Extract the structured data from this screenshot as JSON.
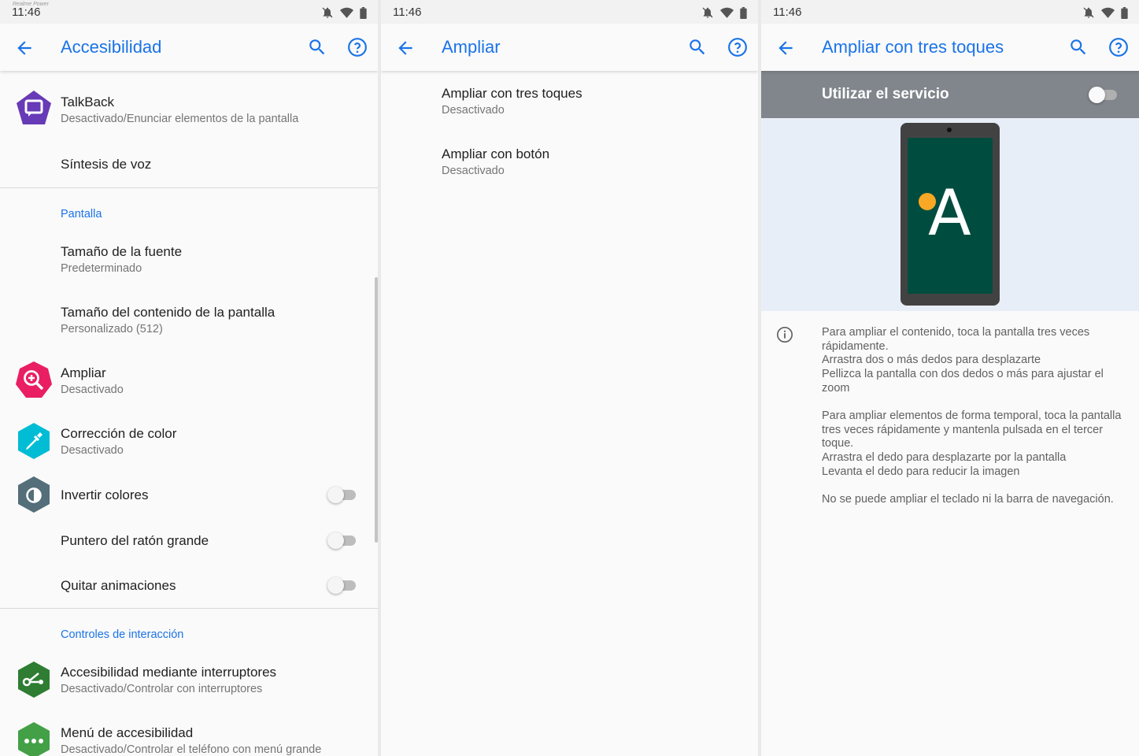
{
  "watermark": "Realme Power",
  "colors": {
    "accent": "#1a73e8",
    "talkback": "#673ab7",
    "magnify": "#e91e63",
    "color_correction": "#00bcd4",
    "invert": "#546e7a",
    "switch_access": "#2e7d32",
    "a11y_menu": "#43a047"
  },
  "screen1": {
    "status_time": "11:46",
    "title": "Accesibilidad",
    "items": [
      {
        "title": "TalkBack",
        "subtitle": "Desactivado/Enunciar elementos de la pantalla",
        "icon": "talkback-icon"
      },
      {
        "title": "Síntesis de voz"
      }
    ],
    "section_display": "Pantalla",
    "display_items": [
      {
        "title": "Tamaño de la fuente",
        "subtitle": "Predeterminado"
      },
      {
        "title": "Tamaño del contenido de la pantalla",
        "subtitle": "Personalizado (512)"
      },
      {
        "title": "Ampliar",
        "subtitle": "Desactivado",
        "icon": "magnification-icon"
      },
      {
        "title": "Corrección de color",
        "subtitle": "Desactivado",
        "icon": "color-correction-icon"
      },
      {
        "title": "Invertir colores",
        "icon": "invert-colors-icon",
        "toggle": false
      },
      {
        "title": "Puntero del ratón grande",
        "toggle": false
      },
      {
        "title": "Quitar animaciones",
        "toggle": false
      }
    ],
    "section_interaction": "Controles de interacción",
    "interaction_items": [
      {
        "title": "Accesibilidad mediante interruptores",
        "subtitle": "Desactivado/Controlar con interruptores",
        "icon": "switch-access-icon"
      },
      {
        "title": "Menú de accesibilidad",
        "subtitle": "Desactivado/Controlar el teléfono con menú grande",
        "icon": "accessibility-menu-icon"
      }
    ]
  },
  "screen2": {
    "status_time": "11:46",
    "title": "Ampliar",
    "items": [
      {
        "title": "Ampliar con tres toques",
        "subtitle": "Desactivado"
      },
      {
        "title": "Ampliar con botón",
        "subtitle": "Desactivado"
      }
    ]
  },
  "screen3": {
    "status_time": "11:46",
    "title": "Ampliar con tres toques",
    "service_label": "Utilizar el servicio",
    "service_on": false,
    "illustration_letter": "A",
    "paragraphs": [
      [
        "Para ampliar el contenido, toca la pantalla tres veces rápidamente.",
        "Arrastra dos o más dedos para desplazarte",
        "Pellizca la pantalla con dos dedos o más para ajustar el zoom"
      ],
      [
        "Para ampliar elementos de forma temporal, toca la pantalla tres veces rápidamente y mantenla pulsada en el tercer toque.",
        "Arrastra el dedo para desplazarte por la pantalla",
        "Levanta el dedo para reducir la imagen"
      ],
      [
        "No se puede ampliar el teclado ni la barra de navegación."
      ]
    ]
  }
}
